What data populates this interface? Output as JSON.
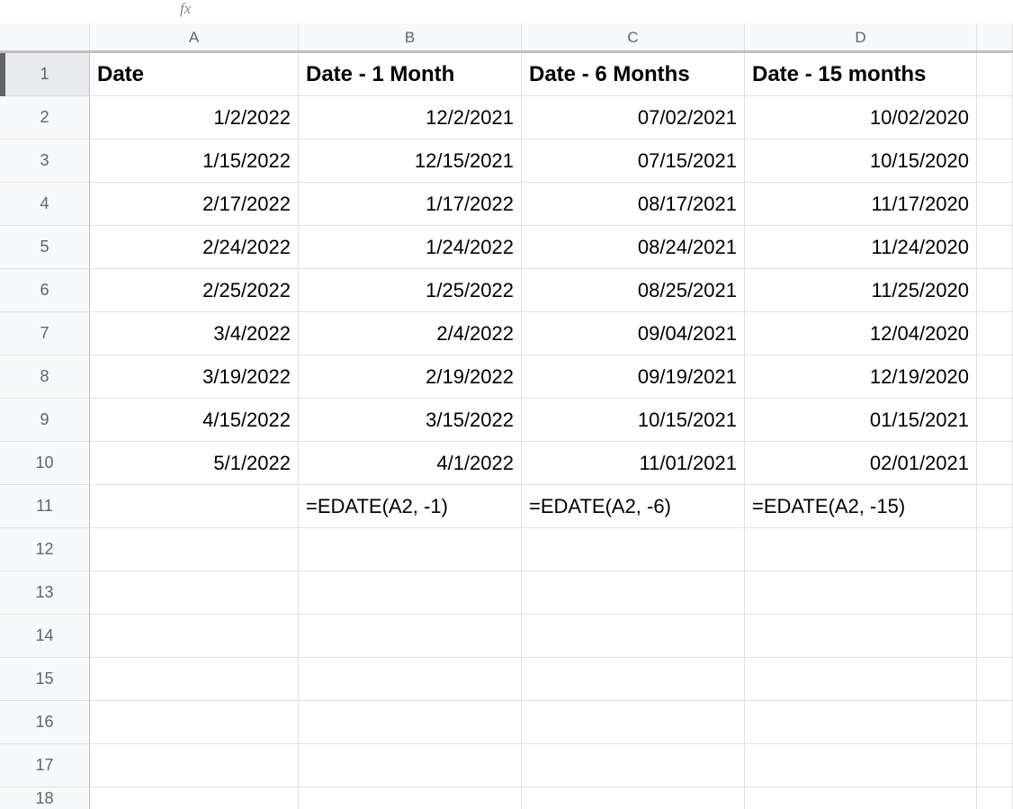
{
  "formula_bar": {
    "fx_label": "fx"
  },
  "columns": [
    "A",
    "B",
    "C",
    "D"
  ],
  "row_numbers": [
    "1",
    "2",
    "3",
    "4",
    "5",
    "6",
    "7",
    "8",
    "9",
    "10",
    "11",
    "12",
    "13",
    "14",
    "15",
    "16",
    "17",
    "18"
  ],
  "headers": {
    "a": "Date",
    "b": "Date - 1 Month",
    "c": "Date - 6 Months",
    "d": "Date - 15 months"
  },
  "data": [
    {
      "a": "1/2/2022",
      "b": "12/2/2021",
      "c": "07/02/2021",
      "d": "10/02/2020"
    },
    {
      "a": "1/15/2022",
      "b": "12/15/2021",
      "c": "07/15/2021",
      "d": "10/15/2020"
    },
    {
      "a": "2/17/2022",
      "b": "1/17/2022",
      "c": "08/17/2021",
      "d": "11/17/2020"
    },
    {
      "a": "2/24/2022",
      "b": "1/24/2022",
      "c": "08/24/2021",
      "d": "11/24/2020"
    },
    {
      "a": "2/25/2022",
      "b": "1/25/2022",
      "c": "08/25/2021",
      "d": "11/25/2020"
    },
    {
      "a": "3/4/2022",
      "b": "2/4/2022",
      "c": "09/04/2021",
      "d": "12/04/2020"
    },
    {
      "a": "3/19/2022",
      "b": "2/19/2022",
      "c": "09/19/2021",
      "d": "12/19/2020"
    },
    {
      "a": "4/15/2022",
      "b": "3/15/2022",
      "c": "10/15/2021",
      "d": "01/15/2021"
    },
    {
      "a": "5/1/2022",
      "b": "4/1/2022",
      "c": "11/01/2021",
      "d": "02/01/2021"
    }
  ],
  "formulas": {
    "b": "=EDATE(A2, -1)",
    "c": "=EDATE(A2, -6)",
    "d": "=EDATE(A2, -15)"
  }
}
